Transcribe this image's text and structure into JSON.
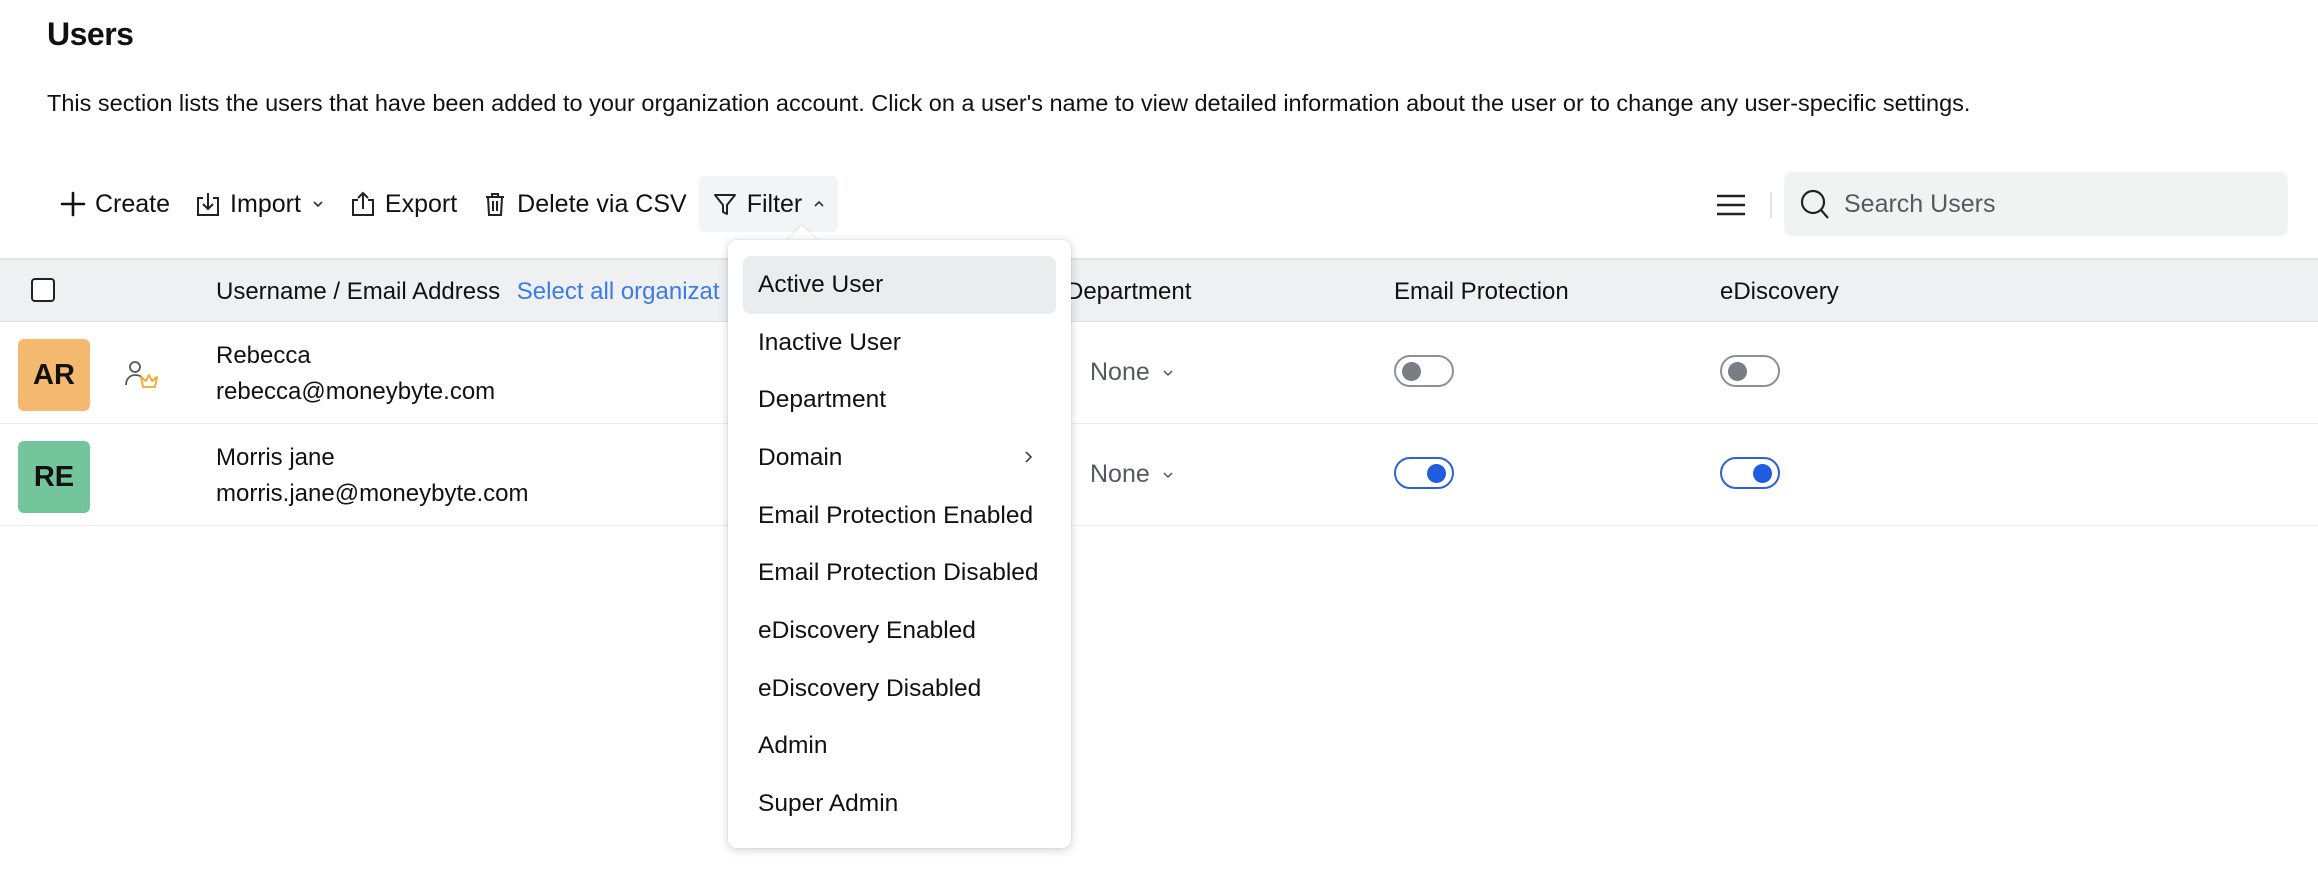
{
  "header": {
    "title": "Users",
    "description": "This section lists the users that have been added to your organization account. Click on a user's name to view detailed information about the user or to change any user-specific settings."
  },
  "toolbar": {
    "create_label": "Create",
    "import_label": "Import",
    "export_label": "Export",
    "delete_csv_label": "Delete via CSV",
    "filter_label": "Filter",
    "icons": {
      "create": "plus-icon",
      "import": "import-icon",
      "export": "export-icon",
      "delete_csv": "trash-icon",
      "filter": "funnel-icon",
      "menu": "hamburger-icon",
      "search": "search-icon"
    }
  },
  "search": {
    "placeholder": "Search Users",
    "value": ""
  },
  "table": {
    "columns": {
      "username": "Username / Email Address",
      "select_all_link": "Select all organizat",
      "department": "Department",
      "email_protection": "Email Protection",
      "ediscovery": "eDiscovery"
    },
    "rows": [
      {
        "initials": "AR",
        "avatar_color": "#f4b96e",
        "role": "super-admin",
        "name": "Rebecca",
        "email": "rebecca@moneybyte.com",
        "department": "None",
        "email_protection": false,
        "ediscovery": false
      },
      {
        "initials": "RE",
        "avatar_color": "#73c69c",
        "role": "user",
        "name": "Morris jane",
        "email": "morris.jane@moneybyte.com",
        "department": "None",
        "email_protection": true,
        "ediscovery": true
      }
    ]
  },
  "filter_menu": {
    "open": true,
    "highlighted": "Active User",
    "items": [
      {
        "label": "Active User"
      },
      {
        "label": "Inactive User"
      },
      {
        "label": "Department"
      },
      {
        "label": "Domain",
        "has_submenu": true
      },
      {
        "label": "Email Protection Enabled"
      },
      {
        "label": "Email Protection Disabled"
      },
      {
        "label": "eDiscovery Enabled"
      },
      {
        "label": "eDiscovery Disabled"
      },
      {
        "label": "Admin"
      },
      {
        "label": "Super Admin"
      }
    ]
  },
  "colors": {
    "accent": "#1f5ce0",
    "link": "#3a7bea",
    "header_bg": "#eff0f2",
    "crown": "#f5a623"
  }
}
